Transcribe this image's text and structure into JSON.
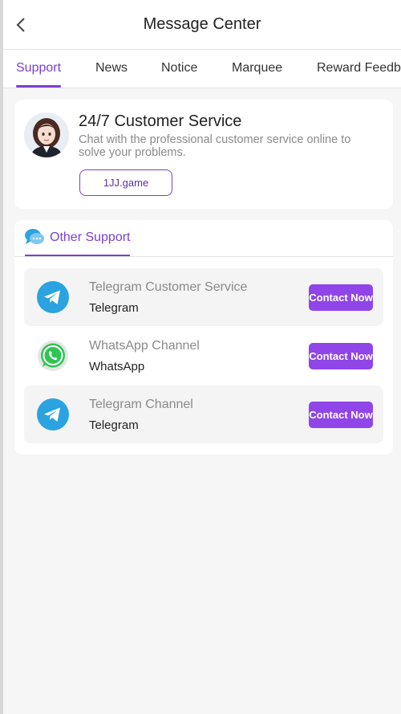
{
  "header": {
    "title": "Message Center",
    "back_icon": "chevron-left-icon"
  },
  "tabs": [
    {
      "label": "Support",
      "active": true
    },
    {
      "label": "News",
      "active": false
    },
    {
      "label": "Notice",
      "active": false
    },
    {
      "label": "Marquee",
      "active": false
    },
    {
      "label": "Reward Feedback",
      "active": false
    }
  ],
  "customer_service": {
    "title": "24/7 Customer Service",
    "description": "Chat with the professional customer service online to solve your problems.",
    "link_label": "1JJ.game",
    "avatar_icon": "agent-avatar-icon"
  },
  "other_support": {
    "title": "Other Support",
    "icon": "chat-bubble-icon",
    "items": [
      {
        "name": "Telegram Customer Service",
        "platform": "Telegram",
        "button": "Contact Now",
        "icon": "telegram-icon"
      },
      {
        "name": "WhatsApp Channel",
        "platform": "WhatsApp",
        "button": "Contact Now",
        "icon": "whatsapp-icon"
      },
      {
        "name": "Telegram Channel",
        "platform": "Telegram",
        "button": "Contact Now",
        "icon": "telegram-icon"
      }
    ]
  },
  "colors": {
    "accent": "#7b3fd0",
    "button": "#8f45e8",
    "background": "#f6f6f6",
    "telegram": "#2aa3e0",
    "whatsapp": "#2ec553"
  }
}
